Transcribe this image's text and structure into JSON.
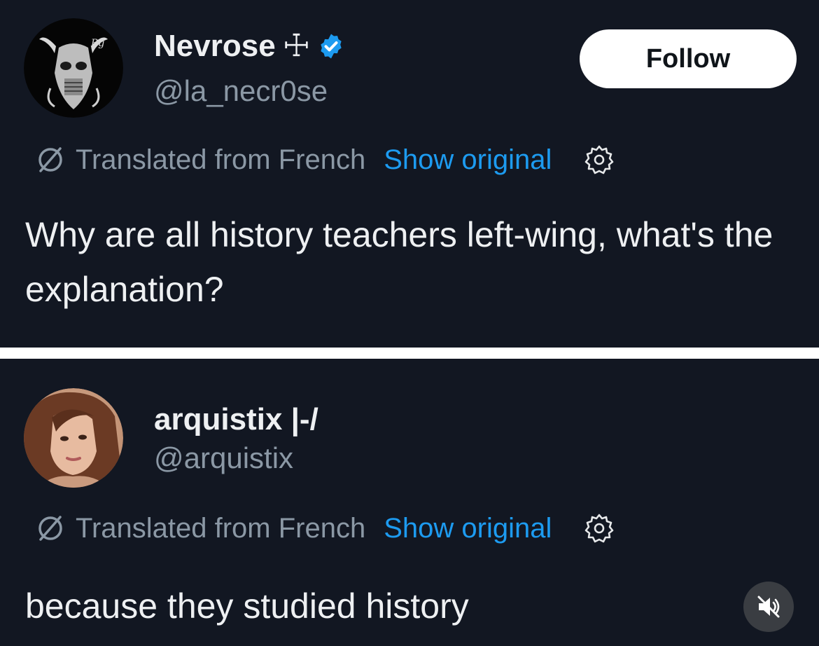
{
  "tweets": [
    {
      "name": "Nevrose",
      "name_symbol": "☩",
      "verified": true,
      "handle": "@la_necr0se",
      "follow_label": "Follow",
      "avatar_icon": "goat-skull-icon",
      "translated_label": "Translated from French",
      "show_original_label": "Show original",
      "text": "Why are all history teachers left-wing, what's the explanation?"
    },
    {
      "name": "arquistix |-/",
      "handle": "@arquistix",
      "avatar_icon": "profile-photo-icon",
      "translated_label": "Translated from French",
      "show_original_label": "Show original",
      "text": "because they studied history"
    }
  ],
  "colors": {
    "background": "#121722",
    "accent": "#1d9bf0",
    "secondary_text": "#8b98a5",
    "divider": "#ffffff"
  },
  "icons": {
    "translate": "translate-slash-icon",
    "settings": "gear-icon",
    "verified": "verified-badge-icon",
    "mute": "muted-speaker-icon"
  }
}
